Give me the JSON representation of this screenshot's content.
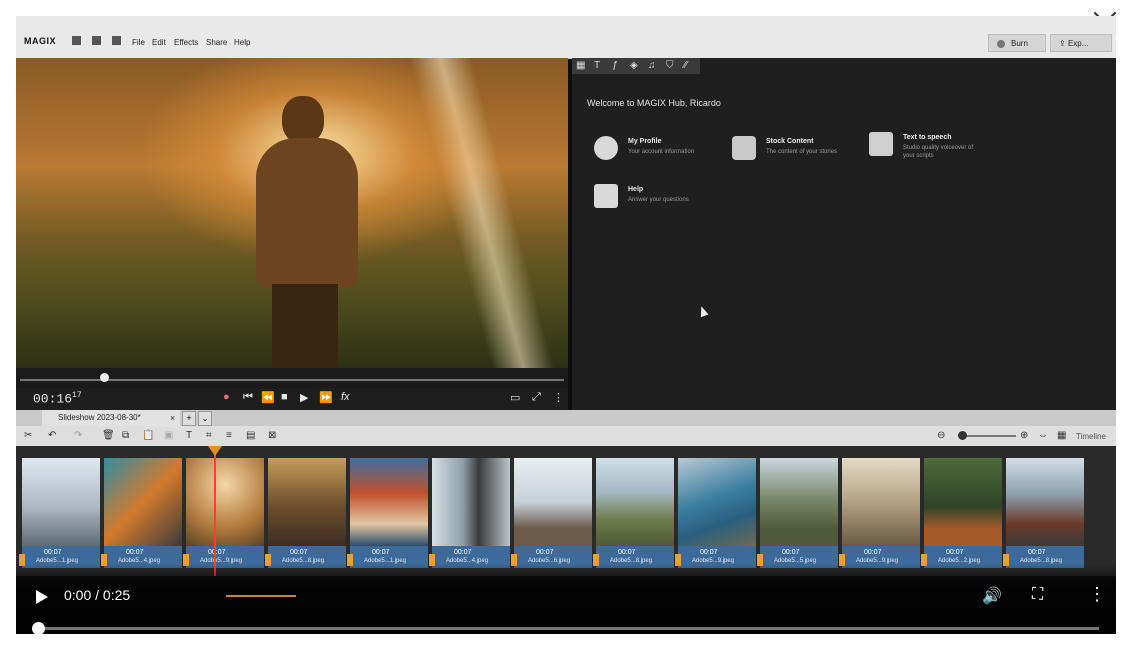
{
  "window": {
    "close_label": "×"
  },
  "app": {
    "logo": "MAGIX",
    "menu": [
      "File",
      "Edit",
      "Effects",
      "Share",
      "Help"
    ],
    "burn_label": "Burn",
    "export_label": "Exp..."
  },
  "preview": {
    "timecode": "00:16",
    "frames": "17",
    "controls": [
      "record-icon",
      "skip-back-icon",
      "rewind-icon",
      "stop-icon",
      "play-icon",
      "fast-forward-icon",
      "fx-icon"
    ],
    "fx_label": "fx"
  },
  "hub": {
    "toolbar_icons": [
      "grid-icon",
      "text-icon",
      "fx-icon",
      "transition-icon",
      "music-icon",
      "store-icon",
      "wand-icon"
    ],
    "welcome": "Welcome to MAGIX Hub, Ricardo",
    "cards": [
      {
        "title": "My Profile",
        "subtitle": "Your account information"
      },
      {
        "title": "Stock Content",
        "subtitle": "The content of your stories"
      },
      {
        "title": "Text to speech",
        "subtitle": "Studio quality voiceover of your scripts"
      },
      {
        "title": "Help",
        "subtitle": "Answer your questions"
      }
    ]
  },
  "timeline": {
    "tab_label": "Slideshow 2023-08-30*",
    "tab_close": "×",
    "tab_add": "+",
    "tab_more": "⌄",
    "view_label": "Timeline",
    "clips": [
      {
        "duration": "00:07",
        "name": "Adobe5...1.jpeg"
      },
      {
        "duration": "00:07",
        "name": "Adobe5...4.jpeg"
      },
      {
        "duration": "00:07",
        "name": "Adobe5...9.jpeg"
      },
      {
        "duration": "00:07",
        "name": "Adobe5...8.jpeg"
      },
      {
        "duration": "00:07",
        "name": "Adobe5...1.jpeg"
      },
      {
        "duration": "00:07",
        "name": "Adobe5...4.jpeg"
      },
      {
        "duration": "00:07",
        "name": "Adobe5...6.jpeg"
      },
      {
        "duration": "00:07",
        "name": "Adobe5...8.jpeg"
      },
      {
        "duration": "00:07",
        "name": "Adobe5...9.jpeg"
      },
      {
        "duration": "00:07",
        "name": "Adobe5...5.jpeg"
      },
      {
        "duration": "00:07",
        "name": "Adobe5...9.jpeg"
      },
      {
        "duration": "00:07",
        "name": "Adobe5...2.jpeg"
      },
      {
        "duration": "00:07",
        "name": "Adobe5...8.jpeg"
      }
    ]
  },
  "player": {
    "time": "0:00 / 0:25",
    "progress": 0.0,
    "icons": [
      "play-icon",
      "volume-icon",
      "fullscreen-icon",
      "more-icon"
    ]
  }
}
